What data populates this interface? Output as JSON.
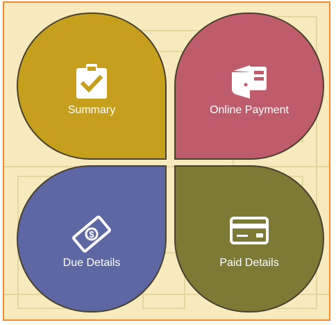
{
  "tiles": [
    {
      "label": "Summary",
      "color": "#c6a01d",
      "icon": "clipboard-check-icon"
    },
    {
      "label": "Online Payment",
      "color": "#bf5c6b",
      "icon": "wallet-icon"
    },
    {
      "label": "Due Details",
      "color": "#5c67a3",
      "icon": "banknote-dollar-icon"
    },
    {
      "label": "Paid Details",
      "color": "#7c7a35",
      "icon": "credit-card-icon"
    }
  ],
  "colors": {
    "frame_border": "#ef8a2e",
    "background": "#f7ebbd",
    "petal_outline": "#4a4030",
    "label_text": "#ffffff"
  }
}
